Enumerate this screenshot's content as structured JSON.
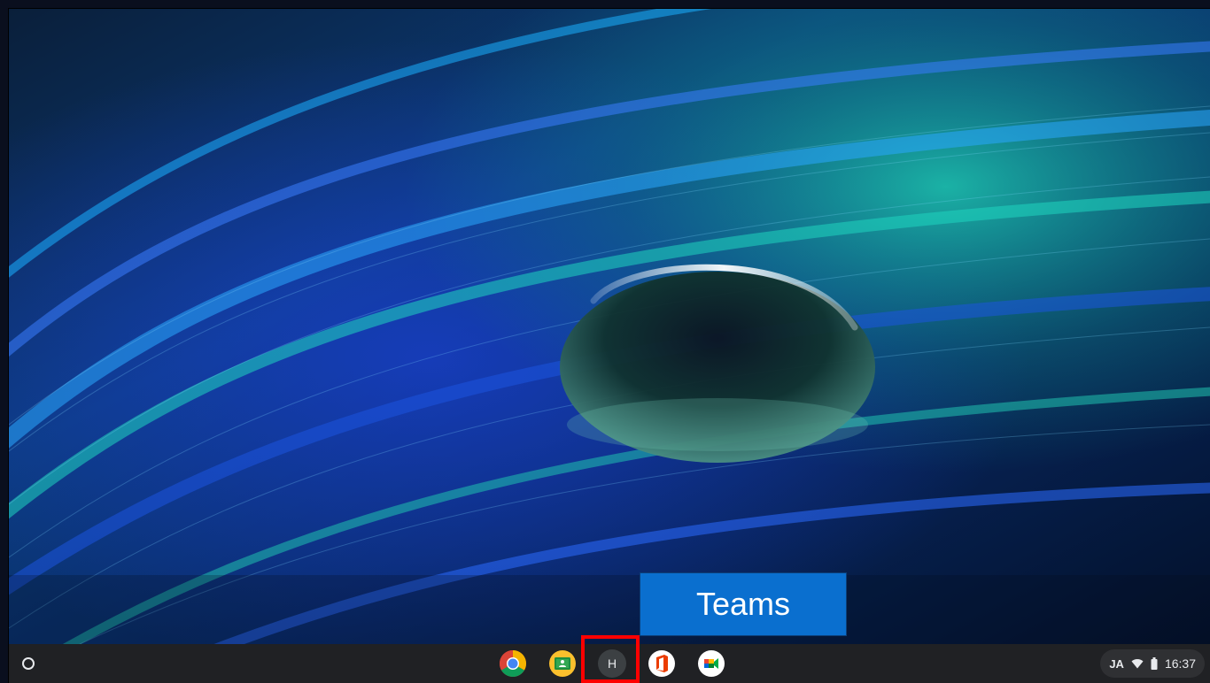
{
  "callout": {
    "text": "Teams"
  },
  "shelf": {
    "launcher_icon": "launcher-circle-icon",
    "apps": [
      {
        "name": "chrome",
        "icon": "chrome-icon"
      },
      {
        "name": "classroom",
        "icon": "classroom-icon"
      },
      {
        "name": "teams",
        "icon": "letter-avatar-icon",
        "letter": "H"
      },
      {
        "name": "office",
        "icon": "office-icon"
      },
      {
        "name": "meet",
        "icon": "meet-icon"
      }
    ]
  },
  "tray": {
    "ime": "JA",
    "wifi_icon": "wifi-icon",
    "battery_icon": "battery-icon",
    "time": "16:37"
  },
  "colors": {
    "shelf_bg": "#202124",
    "callout_bg": "#0a6fcf",
    "highlight": "#ff0000"
  }
}
